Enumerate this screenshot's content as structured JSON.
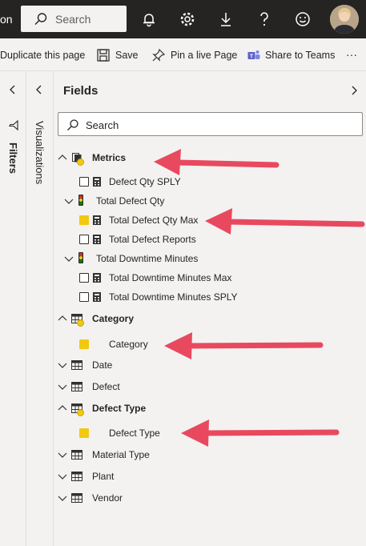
{
  "topbar": {
    "app_fragment": "on",
    "search_placeholder": "Search"
  },
  "commands": {
    "duplicate": "Duplicate this page",
    "save": "Save",
    "pin": "Pin a live Page",
    "share": "Share to Teams",
    "more": "···"
  },
  "panes": {
    "filters_label": "Filters",
    "visualizations_label": "Visualizations",
    "fields_title": "Fields",
    "fields_search_placeholder": "Search"
  },
  "colors": {
    "accent_yellow": "#f2c811",
    "arrow": "#e8495f",
    "topbar": "#252423"
  },
  "tree": {
    "metrics": "Metrics",
    "defect_qty_sply": "Defect Qty SPLY",
    "total_defect_qty": "Total Defect Qty",
    "total_defect_qty_max": "Total Defect Qty Max",
    "total_defect_reports": "Total Defect Reports",
    "total_downtime_minutes": "Total Downtime Minutes",
    "total_downtime_minutes_max": "Total Downtime Minutes Max",
    "total_downtime_minutes_sply": "Total Downtime Minutes SPLY",
    "category_table": "Category",
    "category_field": "Category",
    "date": "Date",
    "defect": "Defect",
    "defect_type_table": "Defect Type",
    "defect_type_field": "Defect Type",
    "material_type": "Material Type",
    "plant": "Plant",
    "vendor": "Vendor"
  }
}
